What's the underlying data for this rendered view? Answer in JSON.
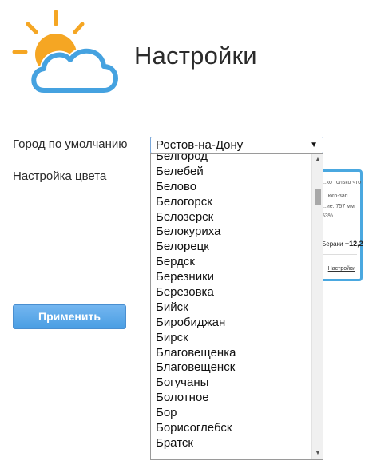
{
  "page": {
    "title": "Настройки"
  },
  "form": {
    "city_label": "Город по умолчанию",
    "color_label": "Настройка цвета",
    "city_selected": "Ростов-на-Дону",
    "apply_label": "Применить"
  },
  "dropdown": {
    "items": [
      "Белгород",
      "Белебей",
      "Белово",
      "Белогорск",
      "Белозерск",
      "Белокуриха",
      "Белорецк",
      "Бердск",
      "Березники",
      "Березовка",
      "Бийск",
      "Биробиджан",
      "Бирск",
      "Благовещенка",
      "Благовещенск",
      "Богучаны",
      "Болотное",
      "Бор",
      "Борисоглебск",
      "Братск"
    ]
  },
  "preview": {
    "line1": "...ко только что",
    "line2": "... юго-зап.",
    "line3": "...ие: 757 мм",
    "line4": "53%",
    "line5_text": "Бераки",
    "line5_value": "+12,2",
    "settings_link": "Настройки"
  },
  "icons": {
    "logo": "sun-cloud-logo",
    "arrow": "dropdown-arrow-icon"
  },
  "colors": {
    "accent": "#4aa8e0",
    "sun": "#f5a623",
    "button": "#4a9ee3"
  }
}
